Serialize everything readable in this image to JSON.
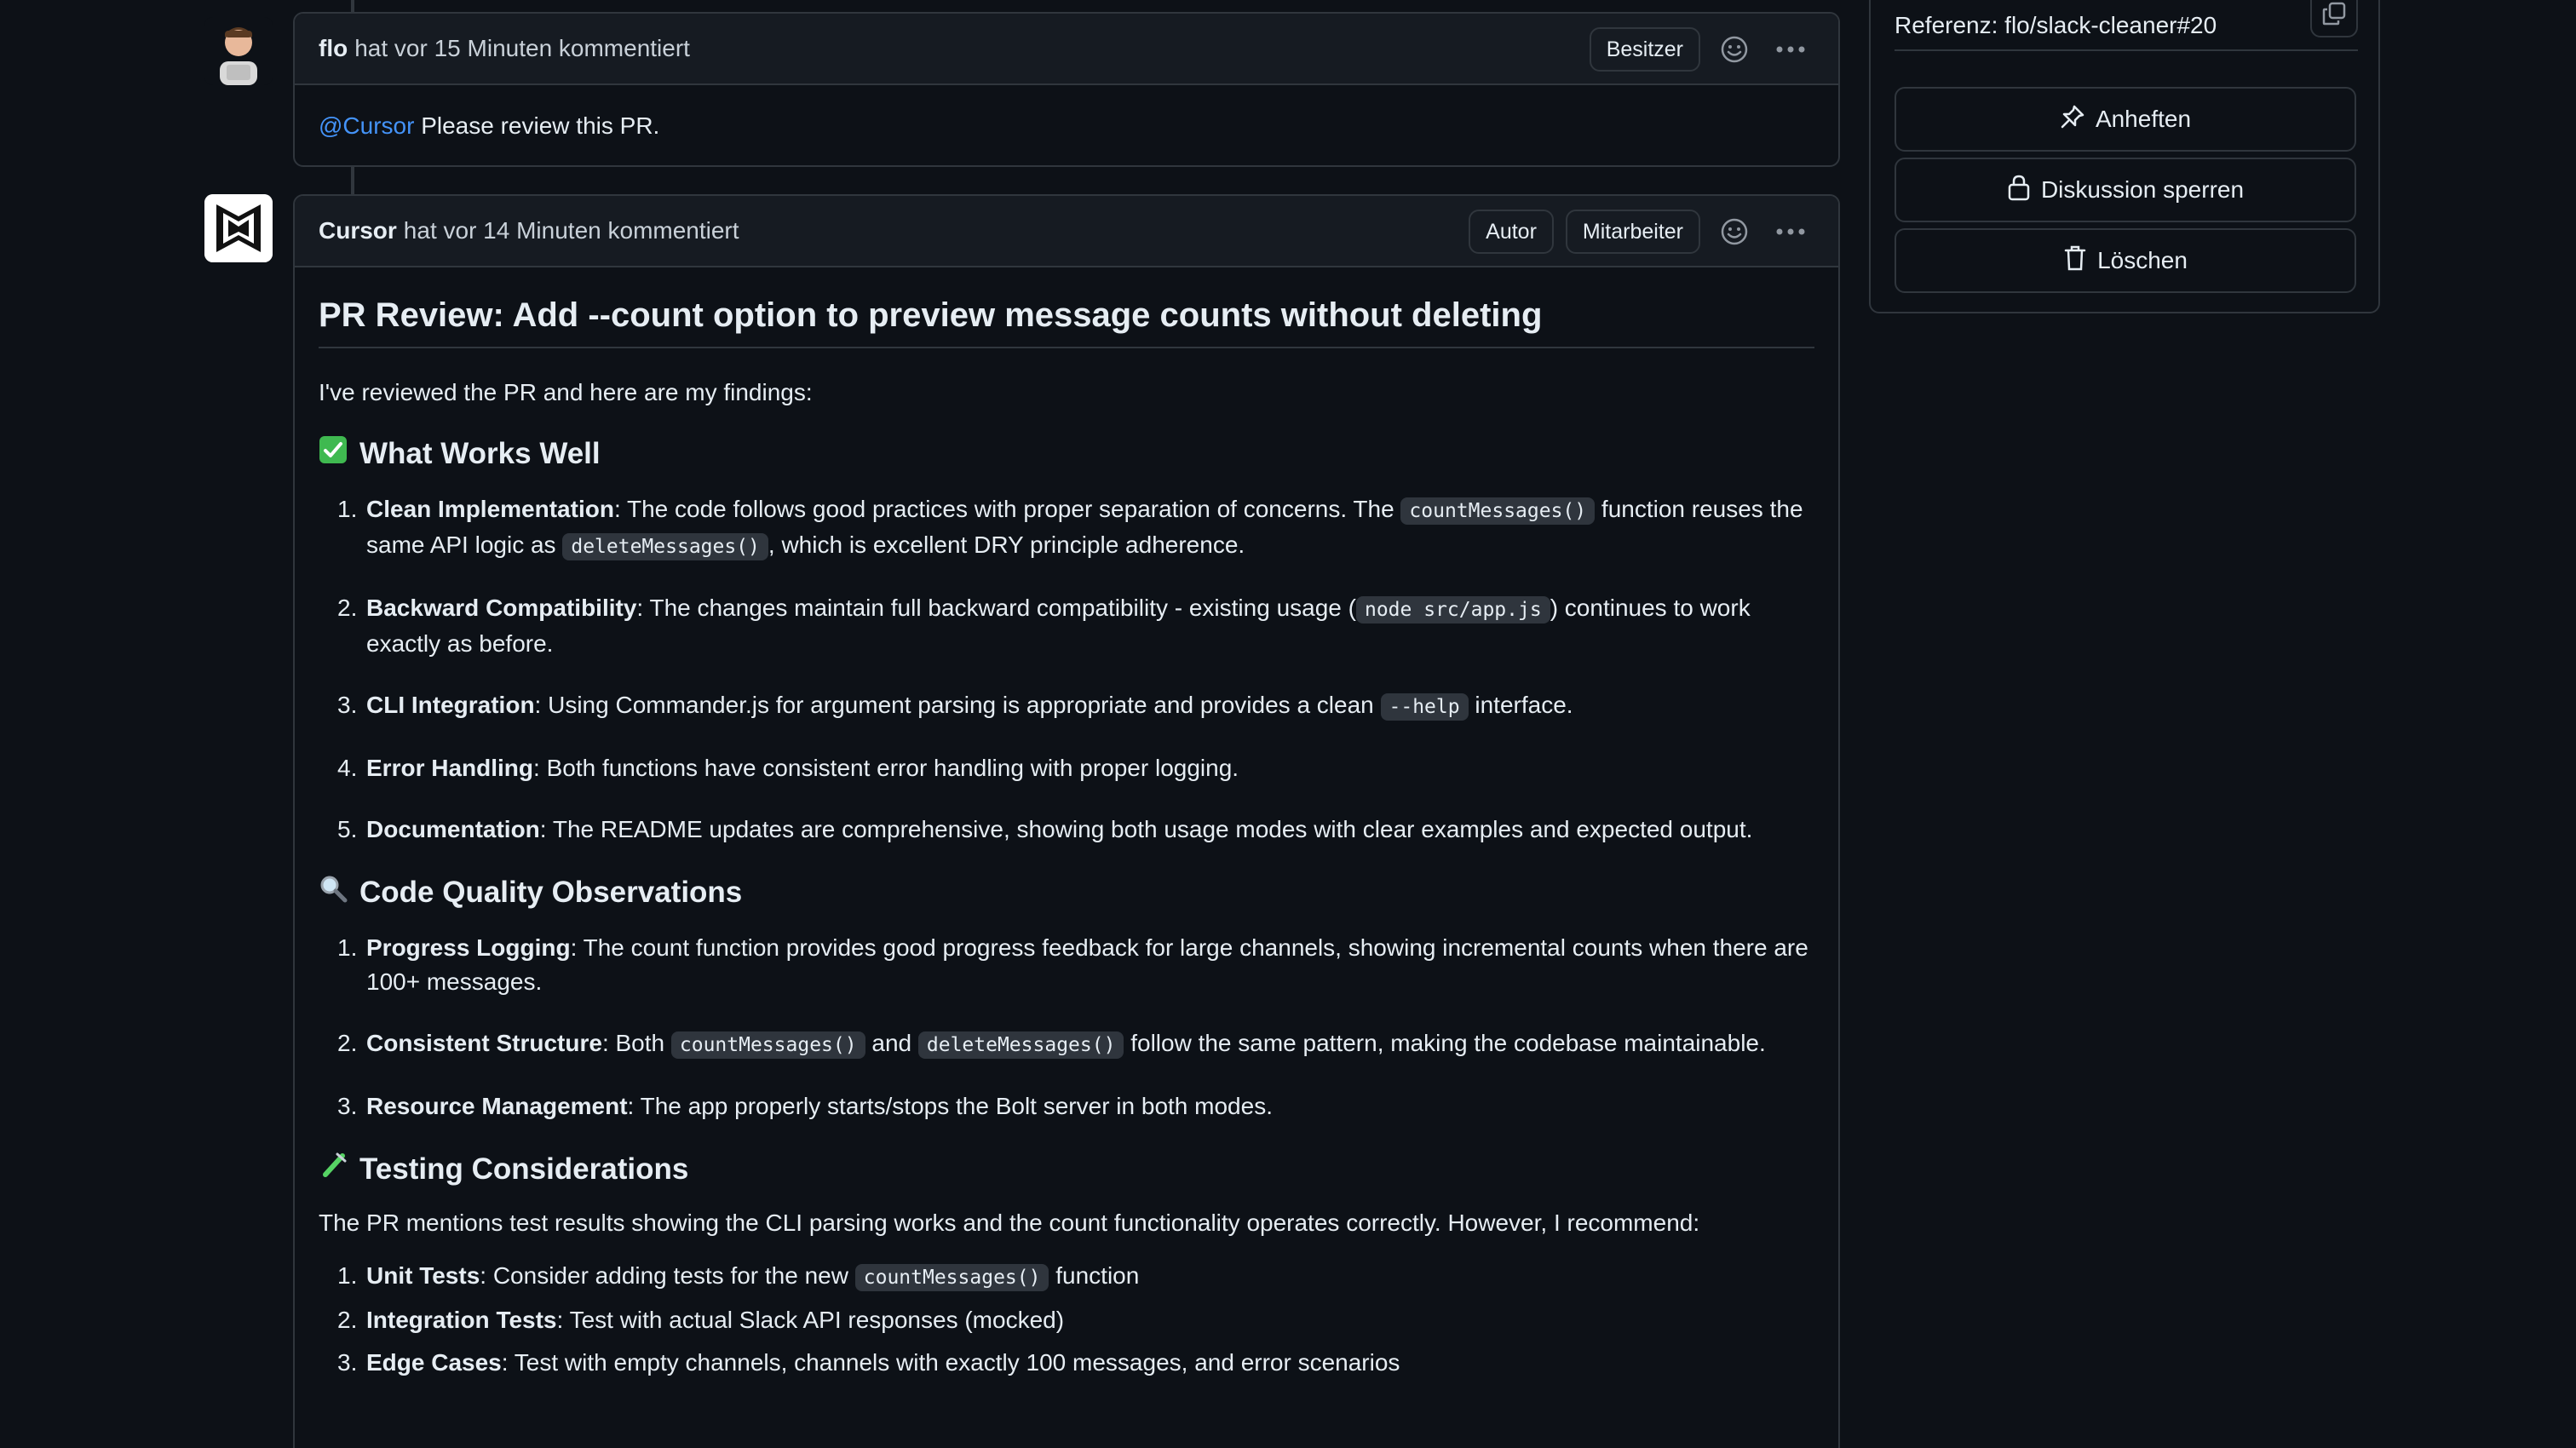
{
  "comments": [
    {
      "author": "flo",
      "meta": "hat vor 15 Minuten kommentiert",
      "badges": [
        "Besitzer"
      ],
      "mention": "@Cursor",
      "text": " Please review this PR."
    },
    {
      "author": "Cursor",
      "meta": "hat vor 14 Minuten kommentiert",
      "badges": [
        "Autor",
        "Mitarbeiter"
      ]
    }
  ],
  "review": {
    "title": "PR Review: Add --count option to preview message counts without deleting",
    "intro": "I've reviewed the PR and here are my findings:",
    "section1": {
      "emoji": "check-mark-emoji",
      "heading": "What Works Well",
      "items": [
        {
          "n": "1.",
          "bold": "Clean Implementation",
          "t1": ": The code follows good practices with proper separation of concerns. The ",
          "c1": "countMessages()",
          "t2": " function reuses the same API logic as ",
          "c2": "deleteMessages()",
          "t3": ", which is excellent DRY principle adherence."
        },
        {
          "n": "2.",
          "bold": "Backward Compatibility",
          "t1": ": The changes maintain full backward compatibility - existing usage (",
          "c1": "node src/app.js",
          "t2": ") continues to work exactly as before."
        },
        {
          "n": "3.",
          "bold": "CLI Integration",
          "t1": ": Using Commander.js for argument parsing is appropriate and provides a clean ",
          "c1": "--help",
          "t2": " interface."
        },
        {
          "n": "4.",
          "bold": "Error Handling",
          "t1": ": Both functions have consistent error handling with proper logging."
        },
        {
          "n": "5.",
          "bold": "Documentation",
          "t1": ": The README updates are comprehensive, showing both usage modes with clear examples and expected output."
        }
      ]
    },
    "section2": {
      "emoji": "magnifier-emoji",
      "heading": "Code Quality Observations",
      "items": [
        {
          "n": "1.",
          "bold": "Progress Logging",
          "t1": ": The count function provides good progress feedback for large channels, showing incremental counts when there are 100+ messages."
        },
        {
          "n": "2.",
          "bold": "Consistent Structure",
          "t1": ": Both ",
          "c1": "countMessages()",
          "t2": " and ",
          "c2": "deleteMessages()",
          "t3": " follow the same pattern, making the codebase maintainable."
        },
        {
          "n": "3.",
          "bold": "Resource Management",
          "t1": ": The app properly starts/stops the Bolt server in both modes."
        }
      ]
    },
    "section3": {
      "emoji": "test-tube-emoji",
      "heading": "Testing Considerations",
      "intro": "The PR mentions test results showing the CLI parsing works and the count functionality operates correctly. However, I recommend:",
      "items": [
        {
          "n": "1.",
          "bold": "Unit Tests",
          "t1": ": Consider adding tests for the new ",
          "c1": "countMessages()",
          "t2": " function"
        },
        {
          "n": "2.",
          "bold": "Integration Tests",
          "t1": ": Test with actual Slack API responses (mocked)"
        },
        {
          "n": "3.",
          "bold": "Edge Cases",
          "t1": ": Test with empty channels, channels with exactly 100 messages, and error scenarios"
        }
      ]
    }
  },
  "sidebar": {
    "reference": "Referenz: flo/slack-cleaner#20",
    "pin": "Anheften",
    "lock": "Diskussion sperren",
    "delete": "Löschen"
  },
  "colors": {
    "background": "#0d1117",
    "header": "#161b22",
    "border": "#30363d",
    "link": "#4493f8",
    "code_bg": "#2f353d"
  }
}
